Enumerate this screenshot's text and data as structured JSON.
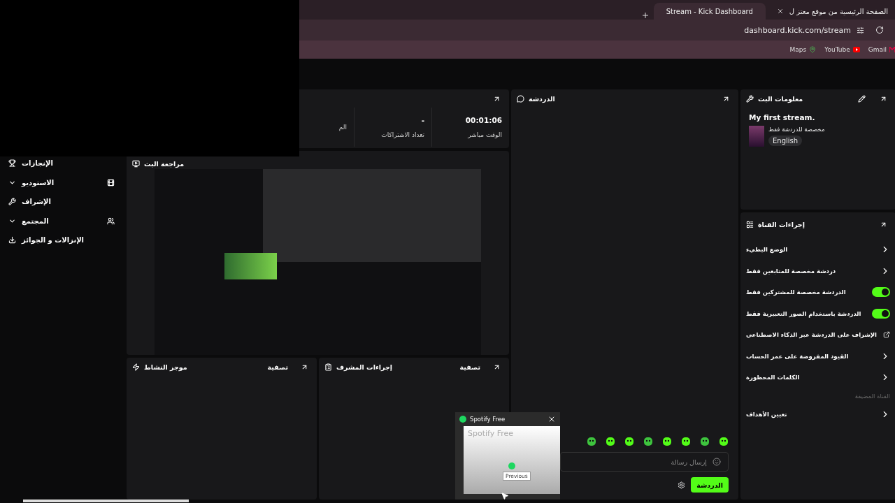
{
  "browser": {
    "tabs": [
      {
        "title": "الصفحة الرئيسية من موقع معتز ل",
        "selected": false
      },
      {
        "title": "Stream - Kick Dashboard",
        "selected": true
      }
    ],
    "url": "dashboard.kick.com/stream",
    "bookmarks": [
      "Gmail",
      "YouTube",
      "Maps"
    ]
  },
  "sidebar": {
    "items": [
      {
        "label": "الإنجازات",
        "kind": "link"
      },
      {
        "label": "الاستوديو",
        "kind": "group"
      },
      {
        "label": "الإشراف",
        "kind": "link"
      },
      {
        "label": "المجتمع",
        "kind": "group"
      },
      {
        "label": "الإنزالات و الجوائز",
        "kind": "link"
      }
    ]
  },
  "stats": {
    "items": [
      {
        "value": "00:01:06",
        "label": "الوقت مباشر"
      },
      {
        "value": "-",
        "label": "تعداد الاشتراكات"
      },
      {
        "label": "الم"
      }
    ]
  },
  "preview": {
    "title": "مراجعة البث"
  },
  "activity": {
    "title": "موجز النشاط",
    "filter": "تصفية"
  },
  "mod_actions": {
    "title": "إجراءات المشرف",
    "filter": "تصفية"
  },
  "chat": {
    "title": "الدردشة",
    "placeholder": "إرسال رسالة",
    "send_button": "الدردشة"
  },
  "stream_info": {
    "title": "معلومات البث",
    "stream_title": "My first stream.",
    "category": "مخصصة للدردشة فقط",
    "language": "English"
  },
  "channel_actions": {
    "title": "إجراءات القناة",
    "items": [
      {
        "label": "الوضع البطيء",
        "kind": "link"
      },
      {
        "label": "دردشة مخصصة للمتابعين فقط",
        "kind": "link"
      },
      {
        "label": "الدردشة مخصصة للمشتركين فقط",
        "kind": "toggle",
        "on": true
      },
      {
        "label": "الدردشة باستخدام الصور التعبيرية فقط",
        "kind": "toggle",
        "on": true
      },
      {
        "label": "الإشراف على الدردشة عبر الذكاء الاصطناعي",
        "kind": "external"
      },
      {
        "label": "القيود المفروضة على عمر الحساب",
        "kind": "link"
      },
      {
        "label": "الكلمات المحظورة",
        "kind": "link"
      },
      {
        "label": "القناة المضيفة",
        "kind": "section"
      },
      {
        "label": "تعيين الأهداف",
        "kind": "link"
      }
    ]
  },
  "spotify": {
    "title": "Spotify Free",
    "preview_text": "Spotify Free",
    "tooltip": "Previous"
  }
}
